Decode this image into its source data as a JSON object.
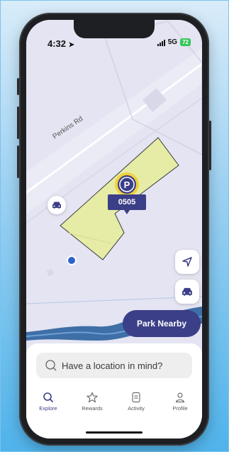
{
  "status_bar": {
    "time": "4:32",
    "network": "5G",
    "battery": "72"
  },
  "map": {
    "road_label": "Perkins Rd",
    "lot_code": "0505",
    "parking_glyph": "P",
    "colors": {
      "background": "#e4e4f2",
      "lot_fill": "#e6eba6",
      "water": "#3e6fa6",
      "accent": "#3b3f87"
    }
  },
  "actions": {
    "park_nearby_label": "Park Nearby"
  },
  "search": {
    "placeholder": "Have a location in mind?"
  },
  "tabs": [
    {
      "label": "Explore",
      "icon": "search-icon",
      "active": true
    },
    {
      "label": "Rewards",
      "icon": "star-icon",
      "active": false
    },
    {
      "label": "Activity",
      "icon": "receipt-icon",
      "active": false
    },
    {
      "label": "Profile",
      "icon": "person-icon",
      "active": false
    }
  ]
}
